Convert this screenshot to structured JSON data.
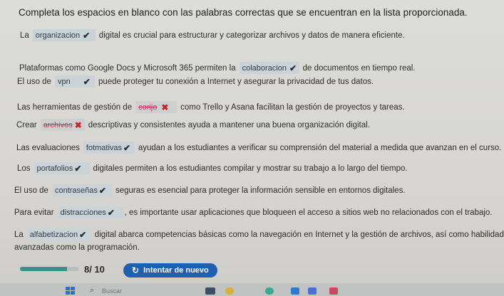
{
  "question": "Completa los espacios en blanco con las palabras correctas que se encuentran en la lista proporcionada.",
  "sentences": [
    {
      "before": "La",
      "answer": "organizacion",
      "after": "digital es crucial para estructurar y categorizar archivos y datos de manera eficiente.",
      "correct": true
    },
    {
      "before": "Plataformas como Google Docs y Microsoft 365 permiten la",
      "answer": "colaboracion",
      "after": "de documentos en tiempo real.",
      "correct": true
    },
    {
      "before": "El uso de",
      "answer": "vpn",
      "after": "puede proteger tu conexión a Internet y asegurar la privacidad de tus datos.",
      "correct": true
    },
    {
      "before": "Las herramientas de gestión de",
      "answer": "corijo",
      "after": "como Trello y Asana facilitan la gestión de proyectos y tareas.",
      "correct": false
    },
    {
      "before": "Crear",
      "answer": "archivos",
      "after": "descriptivas y consistentes ayuda a mantener una buena organización digital.",
      "correct": false
    },
    {
      "before": "Las evaluaciones",
      "answer": "fotmativas",
      "after": "ayudan a los estudiantes a verificar su comprensión del material a medida que avanzan en el curso.",
      "correct": true
    },
    {
      "before": "Los",
      "answer": "portafolios",
      "after": "digitales permiten a los estudiantes compilar y mostrar su trabajo a lo largo del tiempo.",
      "correct": true
    },
    {
      "before": "El uso de",
      "answer": "contraseñas",
      "after": "seguras es esencial para proteger la información sensible en entornos digitales.",
      "correct": true
    },
    {
      "before": "Para evitar",
      "answer": "distracciones",
      "after": ", es importante usar aplicaciones que bloqueen el acceso a sitios web no relacionados con el trabajo.",
      "correct": true
    },
    {
      "before": "La",
      "answer": "alfabetizacion",
      "after": "digital abarca competencias básicas como la navegación en Internet y la gestión de archivos, así como habilidades",
      "after2": "avanzadas como la programación.",
      "correct": true
    }
  ],
  "footer": {
    "score": "8/ 10",
    "progress": 0.8,
    "retry_label": "Intentar de nuevo"
  },
  "taskbar": {
    "search_placeholder": "Buscar"
  },
  "colors": {
    "accent": "#1f5fb0",
    "progress": "#3a8f8a",
    "wrong": "#c4242d"
  }
}
